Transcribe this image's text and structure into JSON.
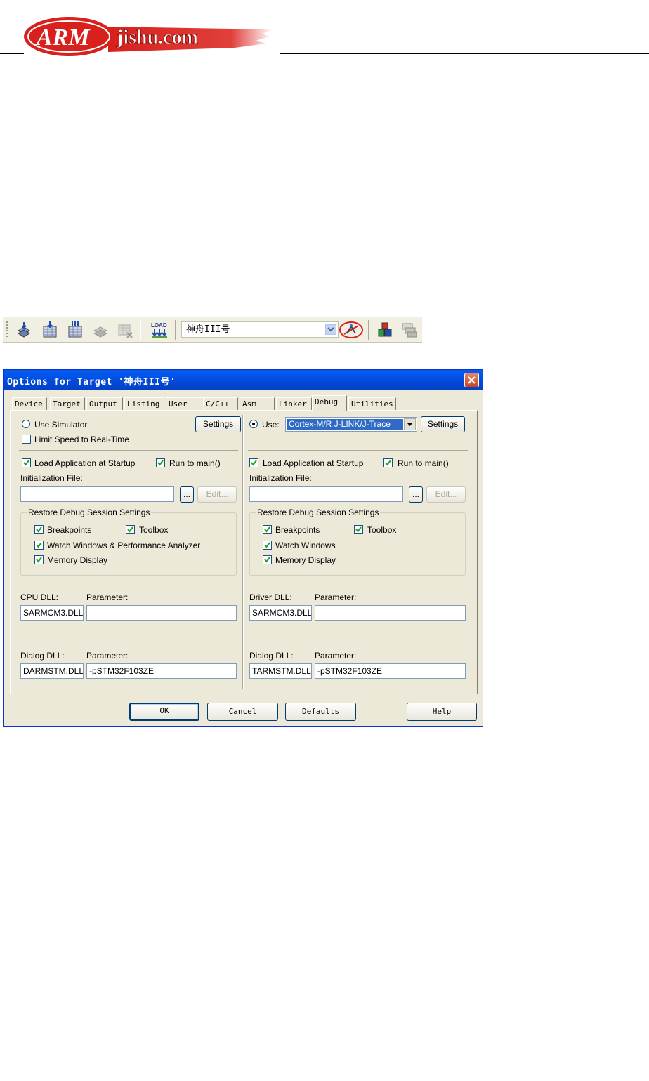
{
  "header": {
    "logo_text_arm": "ARM",
    "logo_text_rest": "jishu.com"
  },
  "toolbar": {
    "buttons": [
      "translate-icon",
      "build-icon",
      "rebuild-icon",
      "batch-build-icon",
      "stop-build-icon",
      "load-download-icon"
    ],
    "load_label": "LOAD",
    "target_combo": "神舟III号",
    "extra_buttons": [
      "wizard-icon",
      "manage-components-icon",
      "select-packs-icon"
    ]
  },
  "dialog": {
    "title": "Options for Target '神舟III号'",
    "tabs": [
      "Device",
      "Target",
      "Output",
      "Listing",
      "User",
      "C/C++",
      "Asm",
      "Linker",
      "Debug",
      "Utilities"
    ],
    "active_tab": "Debug",
    "left": {
      "use_simulator": "Use Simulator",
      "limit_speed": "Limit Speed to Real-Time",
      "settings": "Settings",
      "load_app": "Load Application at Startup",
      "run_to_main": "Run to main()",
      "init_file": "Initialization File:",
      "browse": "...",
      "edit": "Edit...",
      "restore_group": "Restore Debug Session Settings",
      "breakpoints": "Breakpoints",
      "toolbox": "Toolbox",
      "watch_windows": "Watch Windows & Performance Analyzer",
      "memory_display": "Memory Display",
      "cpu_dll_label": "CPU DLL:",
      "cpu_dll_value": "SARMCM3.DLL",
      "param_label": "Parameter:",
      "cpu_param_value": "",
      "dialog_dll_label": "Dialog DLL:",
      "dialog_dll_value": "DARMSTM.DLL",
      "dialog_param_value": "-pSTM32F103ZE"
    },
    "right": {
      "use": "Use:",
      "driver_select": "Cortex-M/R J-LINK/J-Trace",
      "settings": "Settings",
      "load_app": "Load Application at Startup",
      "run_to_main": "Run to main()",
      "init_file": "Initialization File:",
      "browse": "...",
      "edit": "Edit...",
      "restore_group": "Restore Debug Session Settings",
      "breakpoints": "Breakpoints",
      "toolbox": "Toolbox",
      "watch_windows": "Watch Windows",
      "memory_display": "Memory Display",
      "driver_dll_label": "Driver DLL:",
      "driver_dll_value": "SARMCM3.DLL",
      "param_label": "Parameter:",
      "driver_param_value": "",
      "dialog_dll_label": "Dialog DLL:",
      "dialog_dll_value": "TARMSTM.DLL",
      "dialog_param_value": "-pSTM32F103ZE"
    },
    "buttons": {
      "ok": "OK",
      "cancel": "Cancel",
      "defaults": "Defaults",
      "help": "Help"
    }
  },
  "colors": {
    "title_blue": "#0449d6",
    "dialog_bg": "#ece9d8",
    "logo_red": "#d8201c"
  }
}
